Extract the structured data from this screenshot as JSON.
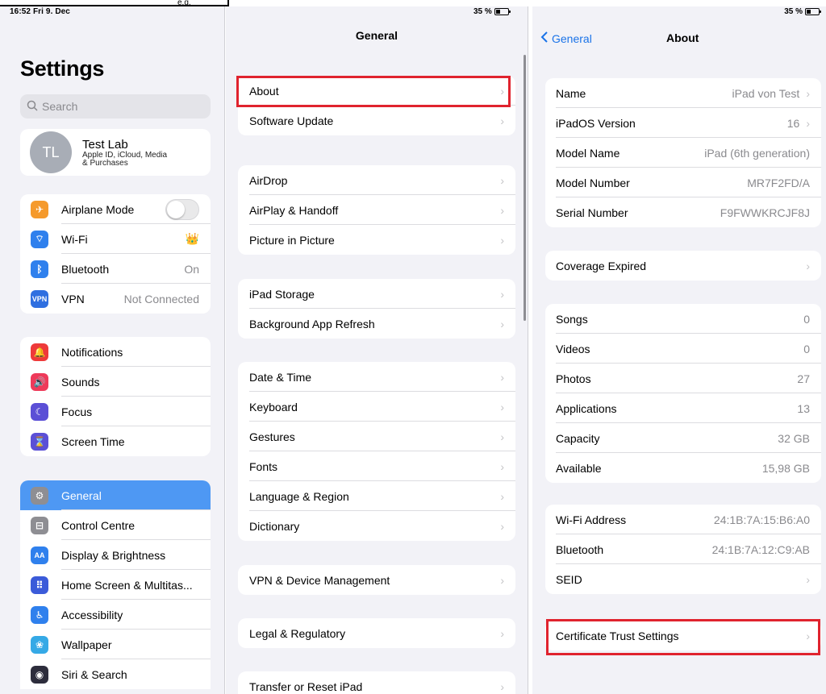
{
  "top_label": "e.g.",
  "status": {
    "time": "16:52  Fri 9. Dec",
    "battery": "35 %"
  },
  "left": {
    "title": "Settings",
    "search_placeholder": "Search",
    "profile": {
      "initials": "TL",
      "name": "Test Lab",
      "sub1": "Apple ID, iCloud, Media",
      "sub2": "& Purchases"
    },
    "group1": [
      {
        "label": "Airplane Mode",
        "icon": "airplane-icon",
        "color": "#f59a2c",
        "glyph": "✈",
        "value": "",
        "toggle": true
      },
      {
        "label": "Wi-Fi",
        "icon": "wifi-icon",
        "color": "#2f80ed",
        "glyph": "⌔",
        "value": "👑"
      },
      {
        "label": "Bluetooth",
        "icon": "bluetooth-icon",
        "color": "#2f80ed",
        "glyph": "ᛒ",
        "value": "On"
      },
      {
        "label": "VPN",
        "icon": "vpn-icon",
        "color": "#2f6fe0",
        "glyph": "VPN",
        "value": "Not Connected"
      }
    ],
    "group2": [
      {
        "label": "Notifications",
        "icon": "notifications-icon",
        "color": "#ee3a3a",
        "glyph": "🔔"
      },
      {
        "label": "Sounds",
        "icon": "sounds-icon",
        "color": "#ee3a5a",
        "glyph": "🔊"
      },
      {
        "label": "Focus",
        "icon": "focus-icon",
        "color": "#5b4fd6",
        "glyph": "☾"
      },
      {
        "label": "Screen Time",
        "icon": "screen-time-icon",
        "color": "#5b4fd6",
        "glyph": "⌛"
      }
    ],
    "group3": [
      {
        "label": "General",
        "icon": "gear-icon",
        "color": "#8e8e93",
        "glyph": "⚙",
        "selected": true
      },
      {
        "label": "Control Centre",
        "icon": "control-centre-icon",
        "color": "#8e8e93",
        "glyph": "⊟"
      },
      {
        "label": "Display & Brightness",
        "icon": "display-icon",
        "color": "#2f80ed",
        "glyph": "AA"
      },
      {
        "label": "Home Screen & Multitas...",
        "icon": "home-screen-icon",
        "color": "#3b5bd9",
        "glyph": "⠿"
      },
      {
        "label": "Accessibility",
        "icon": "accessibility-icon",
        "color": "#2f80ed",
        "glyph": "♿"
      },
      {
        "label": "Wallpaper",
        "icon": "wallpaper-icon",
        "color": "#35a9e6",
        "glyph": "❀"
      },
      {
        "label": "Siri & Search",
        "icon": "siri-icon",
        "color": "#2d2d3c",
        "glyph": "◉"
      }
    ]
  },
  "middle": {
    "title": "General",
    "groups": [
      [
        "About",
        "Software Update"
      ],
      [
        "AirDrop",
        "AirPlay & Handoff",
        "Picture in Picture"
      ],
      [
        "iPad Storage",
        "Background App Refresh"
      ],
      [
        "Date & Time",
        "Keyboard",
        "Gestures",
        "Fonts",
        "Language & Region",
        "Dictionary"
      ],
      [
        "VPN & Device Management"
      ],
      [
        "Legal & Regulatory"
      ],
      [
        "Transfer or Reset iPad"
      ]
    ]
  },
  "right": {
    "back": "General",
    "title": "About",
    "groups": [
      [
        {
          "label": "Name",
          "value": "iPad von Test",
          "chev": true
        },
        {
          "label": "iPadOS Version",
          "value": "16",
          "chev": true
        },
        {
          "label": "Model Name",
          "value": "iPad (6th generation)"
        },
        {
          "label": "Model Number",
          "value": "MR7F2FD/A"
        },
        {
          "label": "Serial Number",
          "value": "F9FWWKRCJF8J"
        }
      ],
      [
        {
          "label": "Coverage Expired",
          "value": "",
          "chev": true
        }
      ],
      [
        {
          "label": "Songs",
          "value": "0"
        },
        {
          "label": "Videos",
          "value": "0"
        },
        {
          "label": "Photos",
          "value": "27"
        },
        {
          "label": "Applications",
          "value": "13"
        },
        {
          "label": "Capacity",
          "value": "32 GB"
        },
        {
          "label": "Available",
          "value": "15,98 GB"
        }
      ],
      [
        {
          "label": "Wi-Fi Address",
          "value": "24:1B:7A:15:B6:A0"
        },
        {
          "label": "Bluetooth",
          "value": "24:1B:7A:12:C9:AB"
        },
        {
          "label": "SEID",
          "value": "",
          "chev": true
        }
      ],
      [
        {
          "label": "Certificate Trust Settings",
          "value": "",
          "chev": true
        }
      ]
    ]
  },
  "highlight_color": "#e0232e",
  "accent_color": "#4e98f3"
}
